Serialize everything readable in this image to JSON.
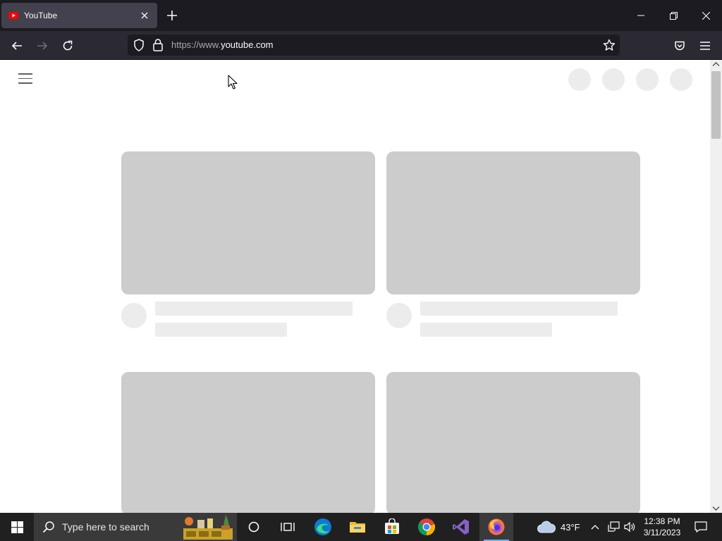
{
  "browser": {
    "tab": {
      "title": "YouTube"
    },
    "url": {
      "prefix": "https://www.",
      "host": "youtube.com"
    }
  },
  "taskbar": {
    "search_placeholder": "Type here to search",
    "weather": {
      "temp": "43°F"
    },
    "clock": {
      "time": "12:38 PM",
      "date": "3/11/2023"
    },
    "pinned": [
      "cortana-icon",
      "task-view-icon",
      "edge-icon",
      "file-explorer-icon",
      "microsoft-store-icon",
      "chrome-icon",
      "visual-studio-icon",
      "firefox-icon"
    ]
  },
  "colors": {
    "skeleton_thumb": "#cccccc",
    "skeleton_line": "#ececec",
    "youtube_red": "#ff0000"
  }
}
